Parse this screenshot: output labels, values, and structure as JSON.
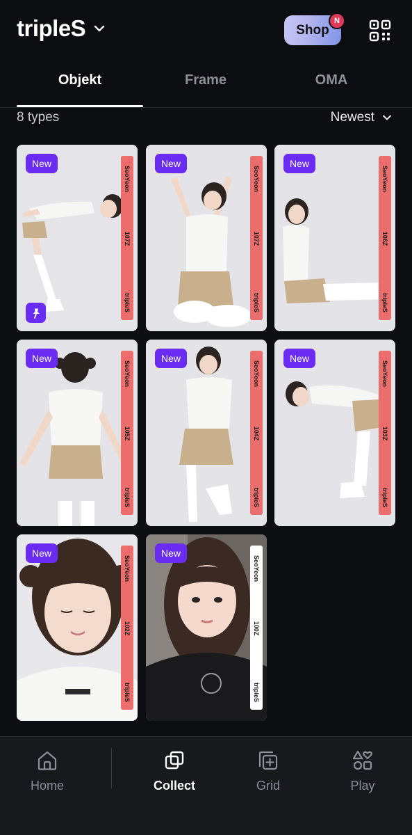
{
  "header": {
    "title": "tripleS",
    "shop_label": "Shop",
    "shop_badge": "N"
  },
  "tabs": [
    {
      "label": "Objekt",
      "active": true
    },
    {
      "label": "Frame",
      "active": false
    },
    {
      "label": "OMA",
      "active": false
    }
  ],
  "filter": {
    "count": "8 types",
    "sort": "Newest"
  },
  "cards": [
    {
      "badge": "New",
      "member": "SeoYeon",
      "number": "107Z",
      "group": "tripleS",
      "stripe_color": "#ec6e6c",
      "pinned": true
    },
    {
      "badge": "New",
      "member": "SeoYeon",
      "number": "107Z",
      "group": "tripleS",
      "stripe_color": "#ec6e6c",
      "pinned": false
    },
    {
      "badge": "New",
      "member": "SeoYeon",
      "number": "106Z",
      "group": "tripleS",
      "stripe_color": "#ec6e6c",
      "pinned": false
    },
    {
      "badge": "New",
      "member": "SeoYeon",
      "number": "105Z",
      "group": "tripleS",
      "stripe_color": "#ec6e6c",
      "pinned": false
    },
    {
      "badge": "New",
      "member": "SeoYeon",
      "number": "104Z",
      "group": "tripleS",
      "stripe_color": "#ec6e6c",
      "pinned": false
    },
    {
      "badge": "New",
      "member": "SeoYeon",
      "number": "103Z",
      "group": "tripleS",
      "stripe_color": "#ec6e6c",
      "pinned": false
    },
    {
      "badge": "New",
      "member": "SeoYeon",
      "number": "102Z",
      "group": "tripleS",
      "stripe_color": "#ec6e6c",
      "pinned": false
    },
    {
      "badge": "New",
      "member": "SeoYeon",
      "number": "100Z",
      "group": "tripleS",
      "stripe_color": "#ffffff",
      "pinned": false
    }
  ],
  "nav": [
    {
      "label": "Home",
      "icon": "home-icon",
      "active": false
    },
    {
      "label": "Collect",
      "icon": "collect-icon",
      "active": true
    },
    {
      "label": "Grid",
      "icon": "grid-icon",
      "active": false
    },
    {
      "label": "Play",
      "icon": "play-icon",
      "active": false
    }
  ],
  "colors": {
    "accent": "#6a2bf2",
    "stripe_red": "#ec6e6c",
    "badge_red": "#e0395b",
    "background": "#0c0d10"
  }
}
